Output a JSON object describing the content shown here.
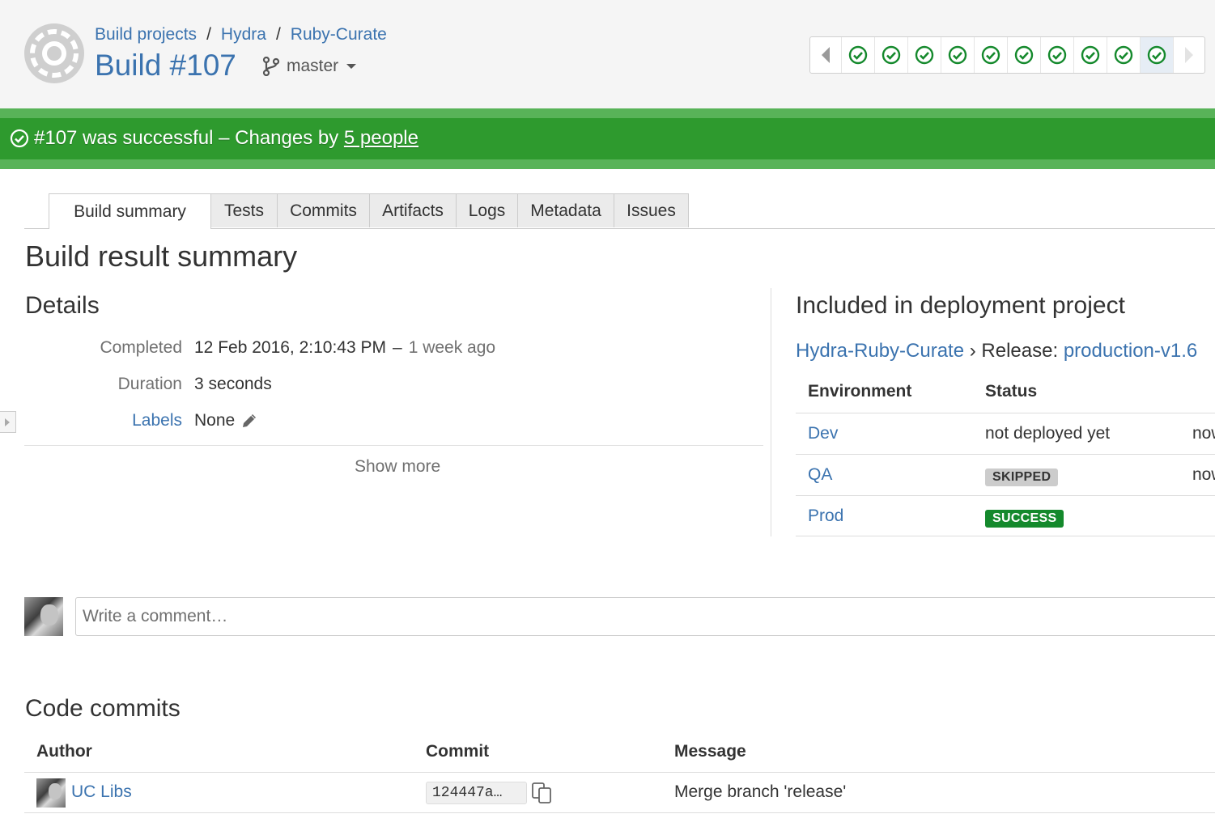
{
  "header": {
    "breadcrumbs": [
      "Build projects",
      "Hydra",
      "Ruby-Curate"
    ],
    "breadcrumb_separator": "/",
    "build_title": "Build #107",
    "branch": "master"
  },
  "history": {
    "result_count": 10,
    "result_status": "success",
    "success_color": "#14892c"
  },
  "status_bar": {
    "prefix": "#107 was successful – Changes by ",
    "people_link": "5 people",
    "color": "#2e9a2e"
  },
  "tabs": [
    "Build summary",
    "Tests",
    "Commits",
    "Artifacts",
    "Logs",
    "Metadata",
    "Issues"
  ],
  "active_tab": "Build summary",
  "page_title": "Build result summary",
  "details": {
    "title": "Details",
    "completed_label": "Completed",
    "completed_value": "12 Feb 2016, 2:10:43 PM",
    "completed_dash": "–",
    "completed_relative": "1 week ago",
    "duration_label": "Duration",
    "duration_value": "3 seconds",
    "labels_label": "Labels",
    "labels_value": "None",
    "show_more": "Show more"
  },
  "deployment": {
    "title": "Included in deployment project",
    "project": "Hydra-Ruby-Curate",
    "separator": "›",
    "release_label": "Release:",
    "release": "production-v1.6",
    "col_environment": "Environment",
    "col_status": "Status",
    "rows": [
      {
        "env": "Dev",
        "status": "not deployed yet",
        "extra": "now"
      },
      {
        "env": "QA",
        "status": "SKIPPED",
        "extra": "now"
      },
      {
        "env": "Prod",
        "status": "SUCCESS",
        "extra": ""
      }
    ]
  },
  "comment": {
    "placeholder": "Write a comment…"
  },
  "commits": {
    "title": "Code commits",
    "col_author": "Author",
    "col_commit": "Commit",
    "col_message": "Message",
    "rows": [
      {
        "author": "UC Libs",
        "hash": "124447a…",
        "message": "Merge branch 'release'"
      }
    ]
  }
}
